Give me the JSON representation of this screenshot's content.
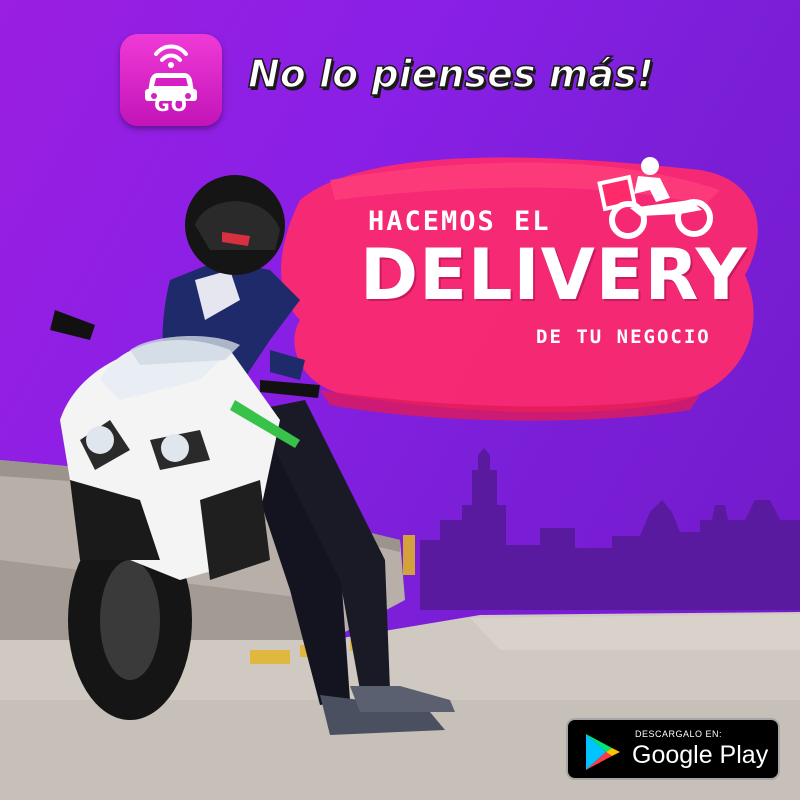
{
  "header": {
    "app_icon_label": "GO",
    "tagline": "No lo pienses más!"
  },
  "headline": {
    "line1": "HACEMOS EL",
    "line2": "DELIVERY",
    "line3": "DE TU NEGOCIO"
  },
  "store_badge": {
    "small_text": "DESCARGALO EN:",
    "store_name": "Google Play"
  },
  "icons": [
    "car-signal-icon",
    "delivery-rider-icon",
    "google-play-icon"
  ],
  "colors": {
    "background": "#8a1fe6",
    "brush": "#ff2a6a",
    "app_icon": "#e030d0",
    "skyline": "#5a1aa0"
  }
}
